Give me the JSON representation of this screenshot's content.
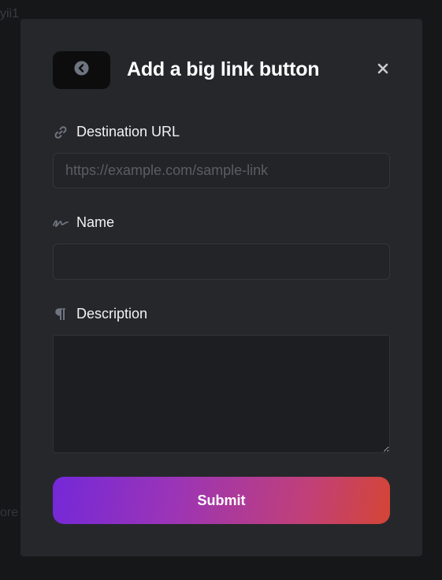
{
  "background": {
    "fragment_top": "yii1",
    "fragment_bottom": "ore"
  },
  "modal": {
    "title": "Add a big link button",
    "back_icon": "chevron-left-circle-icon",
    "close_icon": "close-icon",
    "close_label": "×"
  },
  "fields": {
    "url": {
      "label": "Destination URL",
      "icon": "link-icon",
      "placeholder": "https://example.com/sample-link",
      "value": ""
    },
    "name": {
      "label": "Name",
      "icon": "signature-icon",
      "placeholder": "",
      "value": ""
    },
    "description": {
      "label": "Description",
      "icon": "pilcrow-icon",
      "placeholder": "",
      "value": ""
    }
  },
  "submit": {
    "label": "Submit",
    "gradient_start": "#7428d8",
    "gradient_end": "#d44535"
  },
  "colors": {
    "modal_bg": "#26272b",
    "page_bg": "#161719",
    "icon_muted": "#6e7480"
  }
}
